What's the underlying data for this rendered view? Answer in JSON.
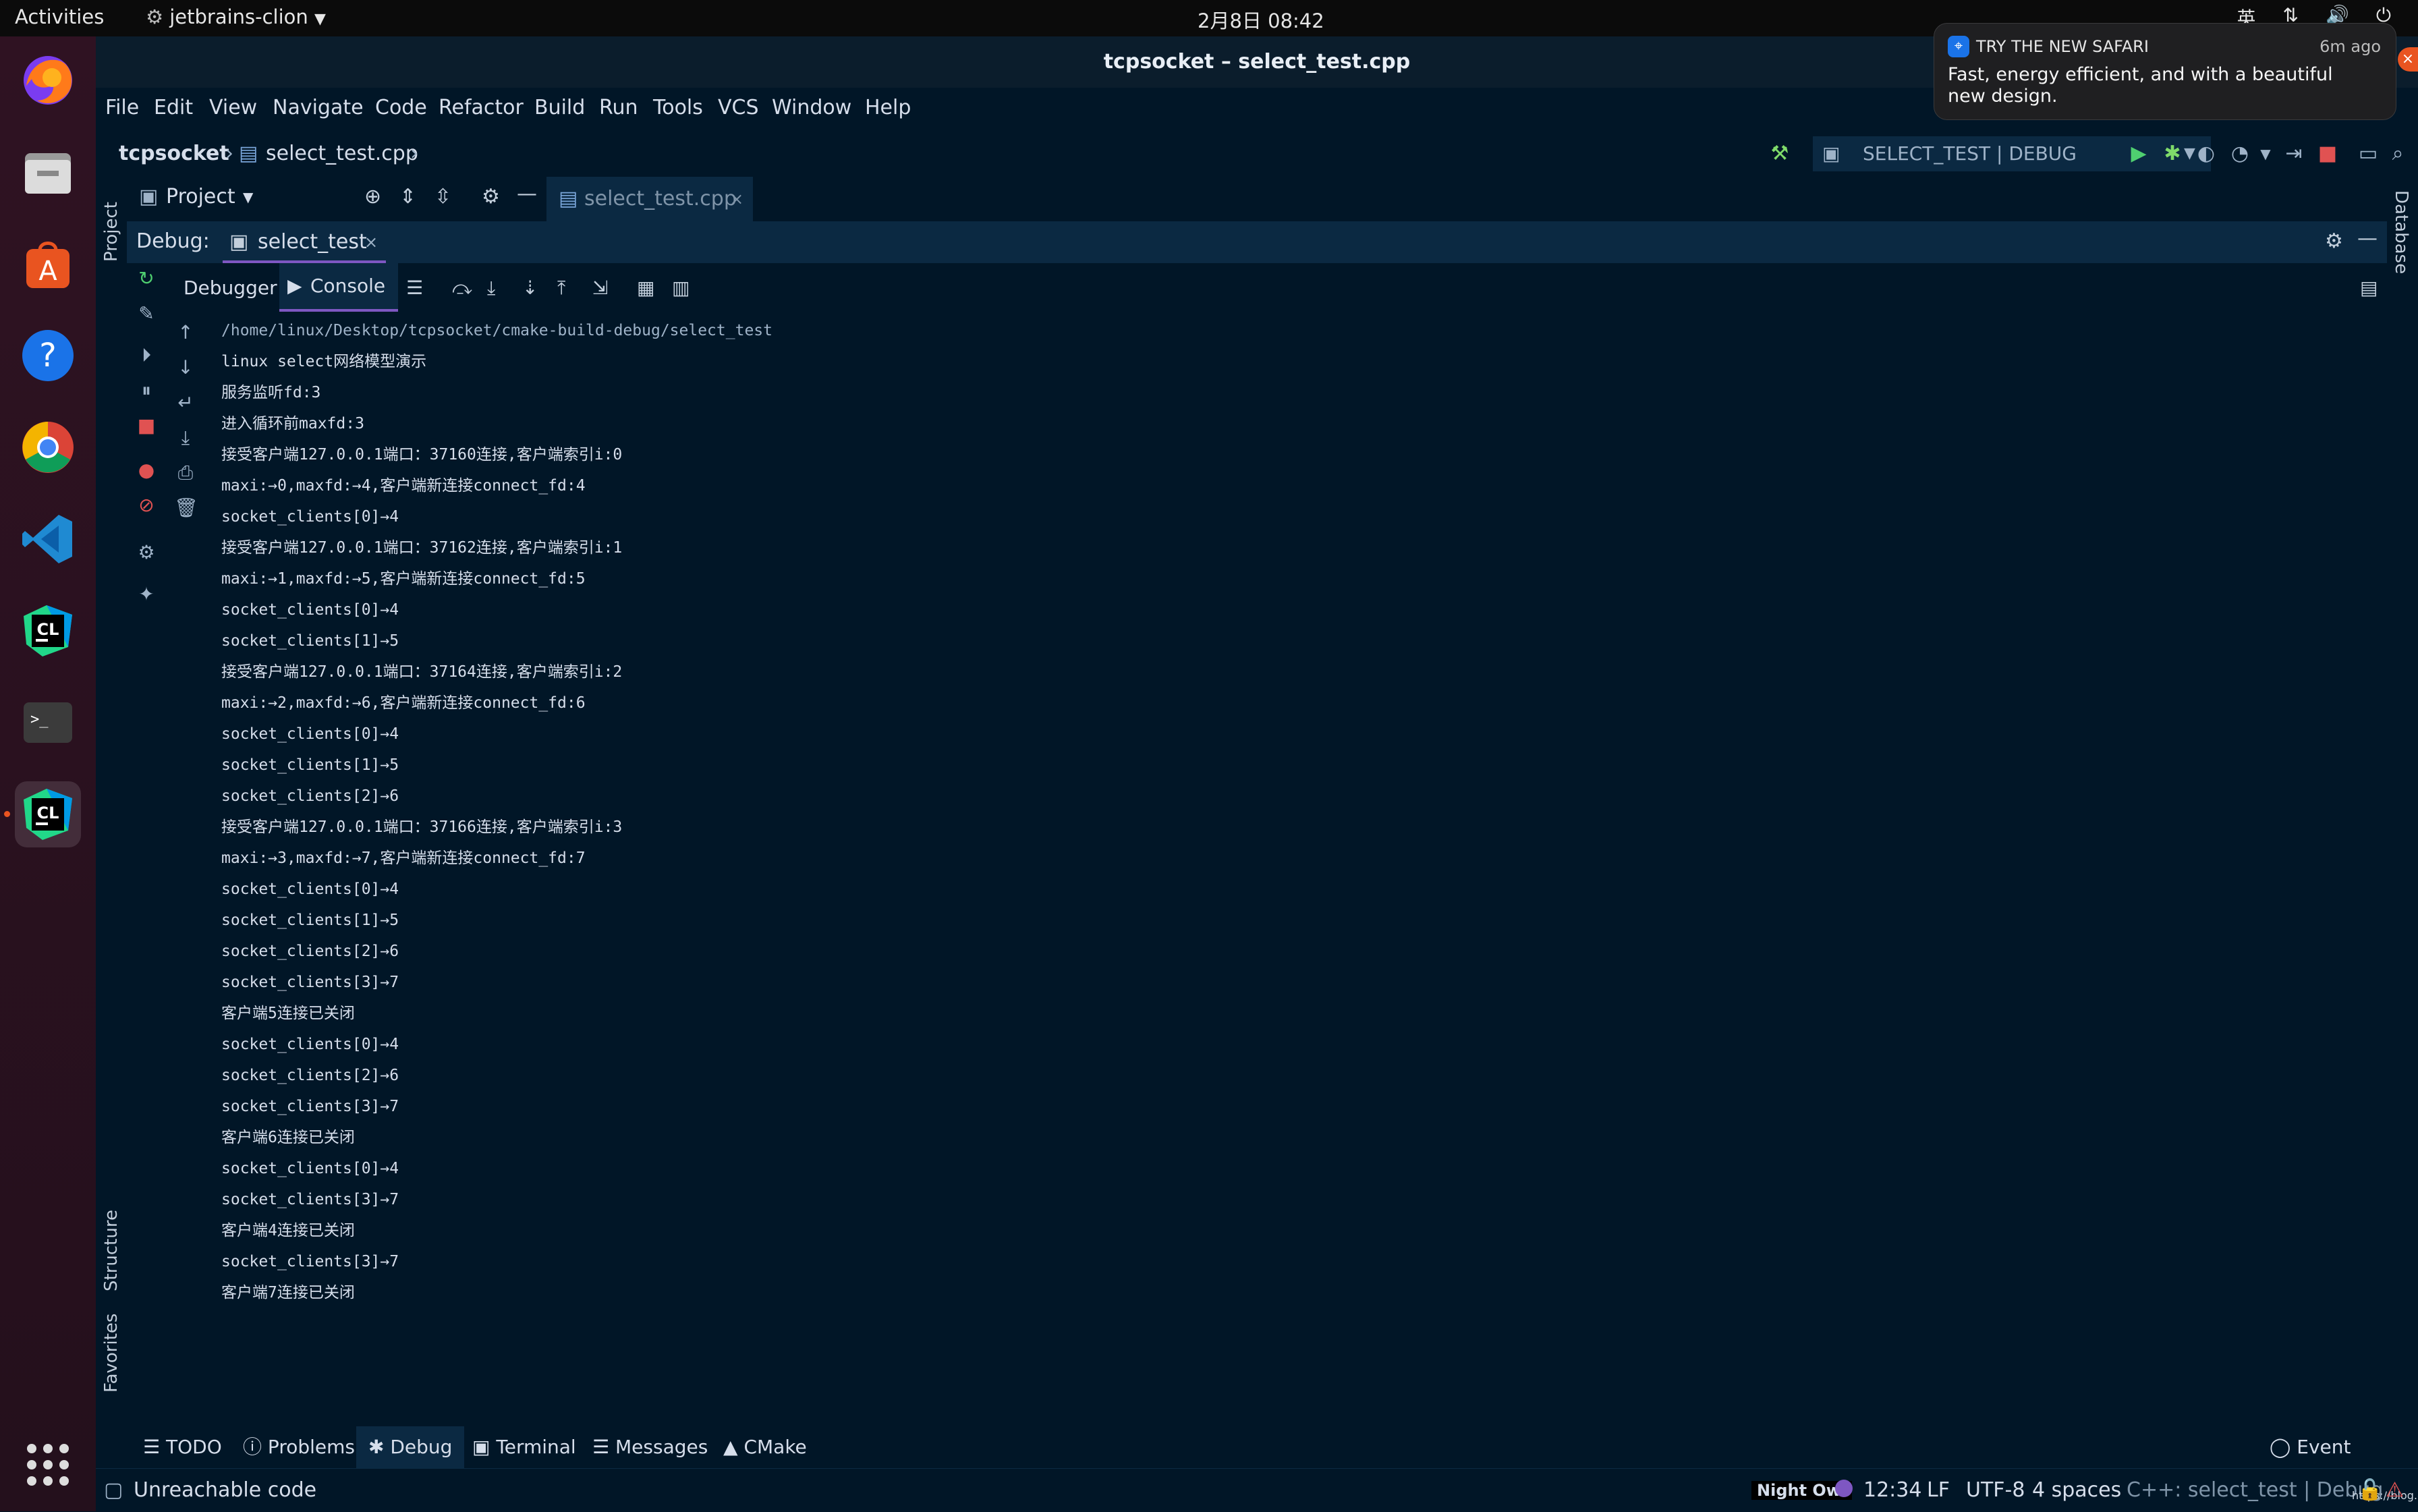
{
  "system_bar": {
    "activities": "Activities",
    "app_menu": "jetbrains-clion",
    "clock": "2月8日  08:42",
    "input_method": "英"
  },
  "dock": {
    "items": [
      "firefox-icon",
      "files-icon",
      "software-center-icon",
      "help-icon",
      "chrome-icon",
      "vscode-icon",
      "clion-icon",
      "terminal-icon",
      "clion-running-icon",
      "app-grid-icon"
    ]
  },
  "window": {
    "title": "tcpsocket – select_test.cpp"
  },
  "menubar": {
    "items": [
      "File",
      "Edit",
      "View",
      "Navigate",
      "Code",
      "Refactor",
      "Build",
      "Run",
      "Tools",
      "VCS",
      "Window",
      "Help"
    ]
  },
  "navbar": {
    "project": "tcpsocket",
    "file": "select_test.cpp",
    "run_config": "SELECT_TEST | DEBUG"
  },
  "project_panel": {
    "label": "Project"
  },
  "editor_tab": {
    "label": "select_test.cpp"
  },
  "debug_window": {
    "label": "Debug:",
    "session": "select_test",
    "tabs": {
      "debugger": "Debugger",
      "console": "Console"
    }
  },
  "side_tabs": {
    "project": "Project",
    "structure": "Structure",
    "favorites": "Favorites",
    "database": "Database"
  },
  "console": {
    "lines": [
      "/home/linux/Desktop/tcpsocket/cmake-build-debug/select_test",
      "linux select网络模型演示",
      "服务监听fd:3",
      "进入循环前maxfd:3",
      "接受客户端127.0.0.1端口：37160连接,客户端索引i:0",
      "maxi:→0,maxfd:→4,客户端新连接connect_fd:4",
      "socket_clients[0]→4",
      "接受客户端127.0.0.1端口：37162连接,客户端索引i:1",
      "maxi:→1,maxfd:→5,客户端新连接connect_fd:5",
      "socket_clients[0]→4",
      "socket_clients[1]→5",
      "接受客户端127.0.0.1端口：37164连接,客户端索引i:2",
      "maxi:→2,maxfd:→6,客户端新连接connect_fd:6",
      "socket_clients[0]→4",
      "socket_clients[1]→5",
      "socket_clients[2]→6",
      "接受客户端127.0.0.1端口：37166连接,客户端索引i:3",
      "maxi:→3,maxfd:→7,客户端新连接connect_fd:7",
      "socket_clients[0]→4",
      "socket_clients[1]→5",
      "socket_clients[2]→6",
      "socket_clients[3]→7",
      "客户端5连接已关闭",
      "socket_clients[0]→4",
      "socket_clients[2]→6",
      "socket_clients[3]→7",
      "客户端6连接已关闭",
      "socket_clients[0]→4",
      "socket_clients[3]→7",
      "客户端4连接已关闭",
      "socket_clients[3]→7",
      "客户端7连接已关闭"
    ]
  },
  "bottom_tabs": {
    "todo": "TODO",
    "problems": "Problems",
    "debug": "Debug",
    "terminal": "Terminal",
    "messages": "Messages",
    "cmake": "CMake",
    "event_log": "Event Log"
  },
  "statusbar": {
    "message": "Unreachable code",
    "theme": "Night Owl",
    "position": "12:34",
    "line_sep": "LF",
    "encoding": "UTF-8",
    "indent": "4 spaces",
    "context": "C++: select_test | Debug",
    "watermark": "https://blog.csdn.net/lifelec"
  },
  "notification": {
    "app": "TRY THE NEW SAFARI",
    "time": "6m ago",
    "body": "Fast, energy efficient, and with a beautiful new design."
  },
  "colors": {
    "background": "#011627",
    "accent": "#7e57c2",
    "panel": "#0b2942"
  }
}
